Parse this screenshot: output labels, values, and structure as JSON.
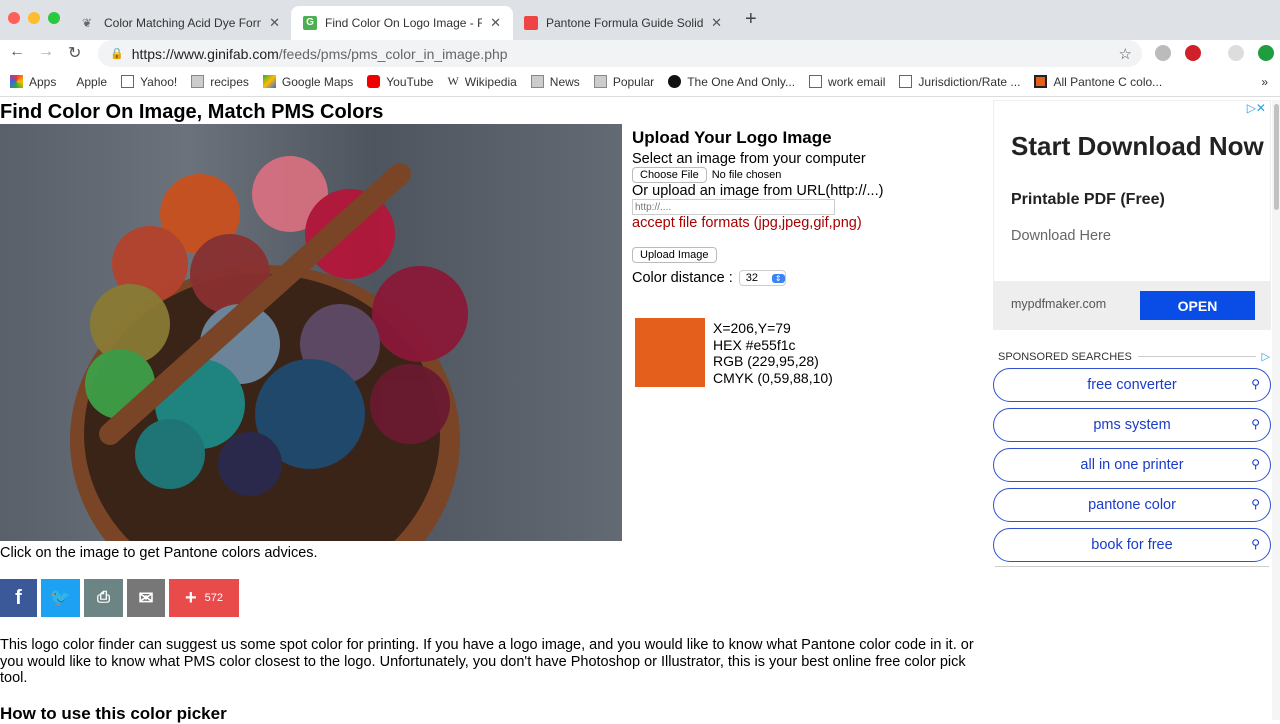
{
  "browser": {
    "tabs": [
      {
        "title": "Color Matching Acid Dye Formu",
        "icon": "dye-icon",
        "active": false
      },
      {
        "title": "Find Color On Logo Image - RGB",
        "icon": "ginifab-icon",
        "active": true
      },
      {
        "title": "Pantone Formula Guide Solid C",
        "icon": "pantone-icon",
        "active": false
      }
    ],
    "new_tab": "+",
    "url_host": "https://www.ginifab.com",
    "url_path": "/feeds/pms/pms_color_in_image.php",
    "bookmarks": [
      {
        "label": "Apps",
        "icon": "apps-grid-icon"
      },
      {
        "label": "Apple",
        "icon": "apple-icon"
      },
      {
        "label": "Yahoo!",
        "icon": "page-icon"
      },
      {
        "label": "recipes",
        "icon": "folder-icon"
      },
      {
        "label": "Google Maps",
        "icon": "maps-icon"
      },
      {
        "label": "YouTube",
        "icon": "youtube-icon"
      },
      {
        "label": "Wikipedia",
        "icon": "wikipedia-icon"
      },
      {
        "label": "News",
        "icon": "folder-icon"
      },
      {
        "label": "Popular",
        "icon": "folder-icon"
      },
      {
        "label": "The One And Only...",
        "icon": "fr-icon"
      },
      {
        "label": "work email",
        "icon": "page-icon"
      },
      {
        "label": "Jurisdiction/Rate ...",
        "icon": "page-icon"
      },
      {
        "label": "All Pantone C colo...",
        "icon": "pantone-icon"
      }
    ],
    "more": "»"
  },
  "page": {
    "title": "Find Color On Image, Match PMS Colors",
    "upload": {
      "heading": "Upload Your Logo Image",
      "select_label": "Select an image from your computer",
      "choose_file": "Choose File",
      "no_file": "No file chosen",
      "url_label": "Or upload an image from URL(http://...)",
      "url_placeholder": "http://....",
      "formats": "accept file formats (jpg,jpeg,gif,png)",
      "upload_button": "Upload Image",
      "distance_label": "Color distance :",
      "distance_value": "32"
    },
    "picked": {
      "color": "#e55f1c",
      "xy": "X=206,Y=79",
      "hex": "HEX #e55f1c",
      "rgb": "RGB (229,95,28)",
      "cmyk": "CMYK (0,59,88,10)"
    },
    "caption": "Click on the image to get Pantone colors advices.",
    "share": {
      "count": "572"
    },
    "description": "This logo color finder can suggest us some spot color for printing. If you have a logo image, and you would like to know what Pantone color code in it. or you would like to know what PMS color closest to the logo. Unfortunately, you don't have Photoshop or Illustrator, this is your best online free color pick tool.",
    "how_to": "How to use this color picker"
  },
  "ad": {
    "headline": "Start Download Now",
    "sub": "Printable PDF (Free)",
    "desc": "Download Here",
    "domain": "mypdfmaker.com",
    "cta": "OPEN",
    "cta_color": "#0a4de6"
  },
  "sponsored": {
    "label": "SPONSORED SEARCHES",
    "items": [
      "free converter",
      "pms system",
      "all in one printer",
      "pantone color",
      "book for free"
    ]
  }
}
